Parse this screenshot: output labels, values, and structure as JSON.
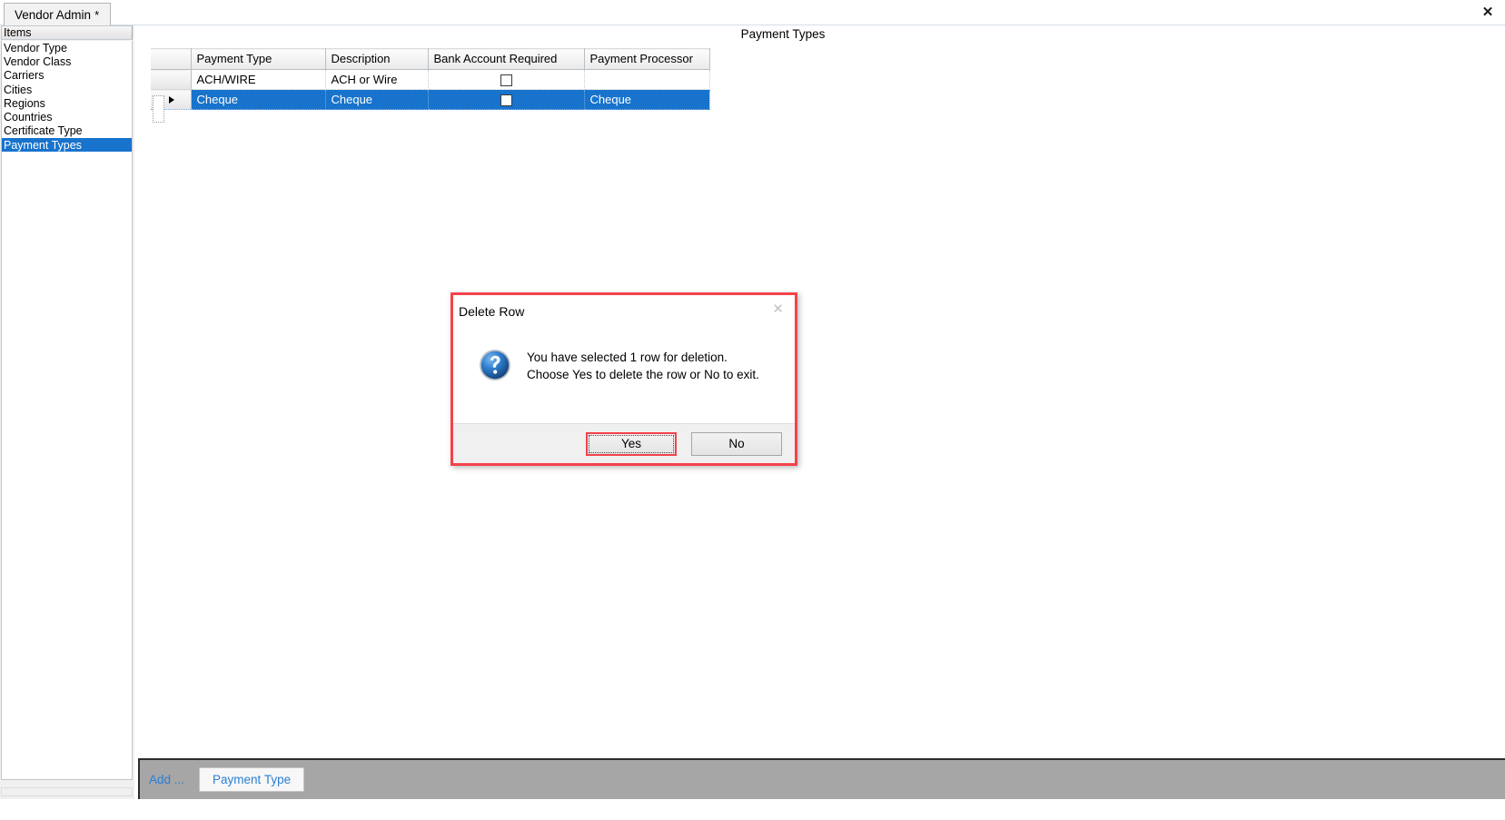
{
  "window": {
    "tab_label": "Vendor Admin",
    "tab_modified_marker": "*",
    "close_icon": "close-icon",
    "close_glyph": "✕"
  },
  "sidebar": {
    "header": "Items",
    "items": [
      {
        "label": "Vendor Type",
        "selected": false
      },
      {
        "label": "Vendor Class",
        "selected": false
      },
      {
        "label": "Carriers",
        "selected": false
      },
      {
        "label": "Cities",
        "selected": false
      },
      {
        "label": "Regions",
        "selected": false
      },
      {
        "label": "Countries",
        "selected": false
      },
      {
        "label": "Certificate Type",
        "selected": false
      },
      {
        "label": "Payment Types",
        "selected": true
      }
    ],
    "selection_color": "#1873cc"
  },
  "main": {
    "title": "Payment Types"
  },
  "grid": {
    "columns": [
      "Payment Type",
      "Description",
      "Bank Account Required",
      "Payment Processor"
    ],
    "rows": [
      {
        "row_indicator": "",
        "payment_type": "ACH/WIRE",
        "description": "ACH or Wire",
        "bank_account_required": false,
        "payment_processor": "",
        "selected": false
      },
      {
        "row_indicator": "current-row-arrow",
        "payment_type": "Cheque",
        "description": "Cheque",
        "bank_account_required": false,
        "payment_processor": "Cheque",
        "selected": true
      }
    ]
  },
  "bottom_bar": {
    "add_label": "Add ...",
    "payment_type_button": "Payment Type",
    "link_color": "#2a7fd4"
  },
  "dialog": {
    "title": "Delete Row",
    "close_glyph": "✕",
    "icon": "question-mark-icon",
    "message_line_1": "You have selected 1 row for deletion.",
    "message_line_2": "Choose Yes to delete the row or No to exit.",
    "yes_label": "Yes",
    "no_label": "No",
    "highlight_color": "#f5424b",
    "default_button": "Yes"
  }
}
